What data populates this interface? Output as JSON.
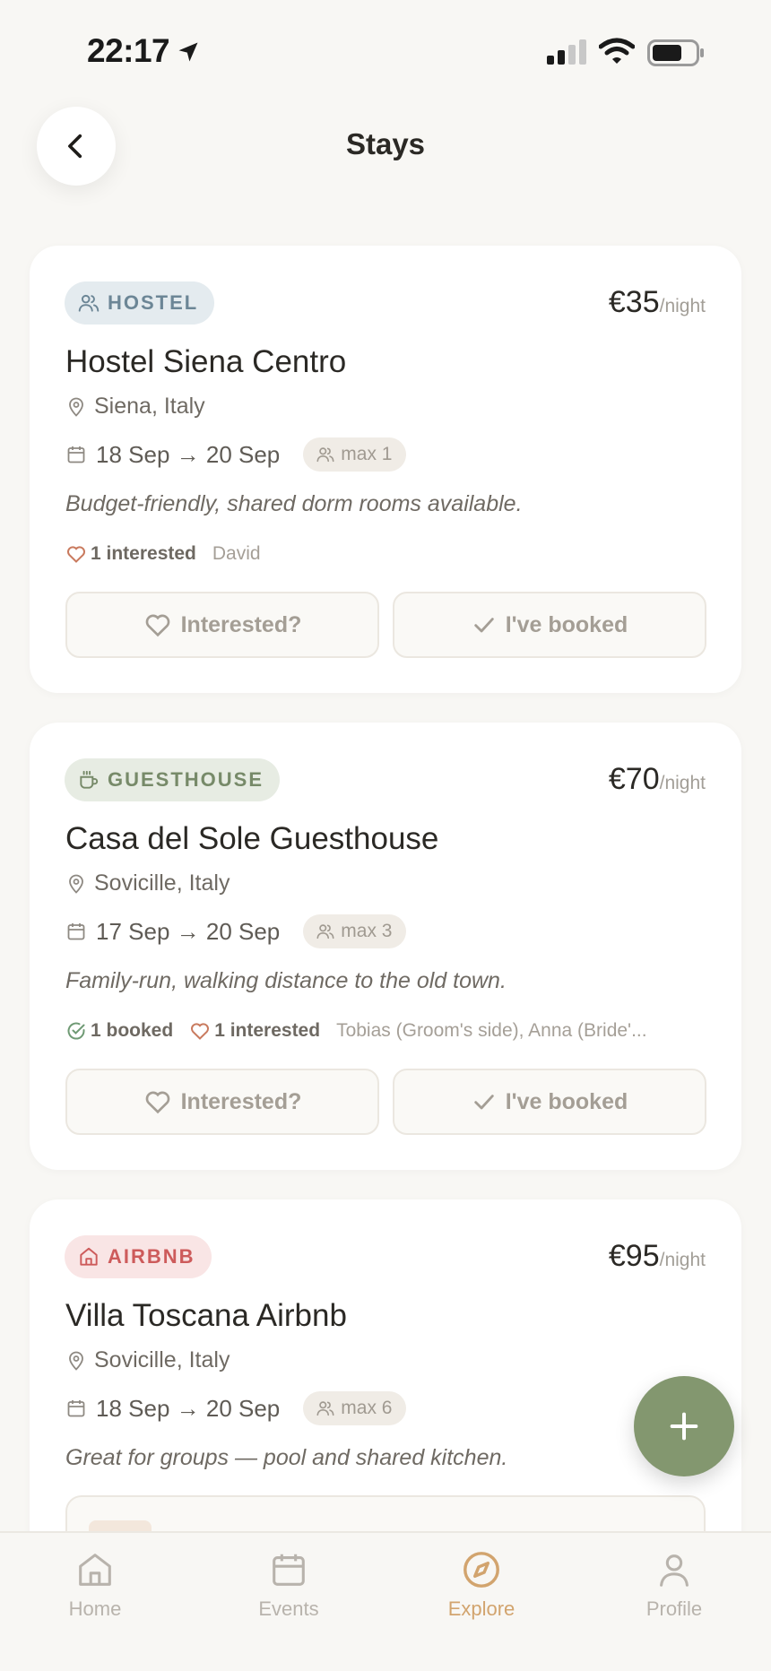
{
  "status_bar": {
    "time": "22:17"
  },
  "header": {
    "title": "Stays"
  },
  "stays": [
    {
      "type_label": "HOSTEL",
      "price": "€35",
      "per_night": "/night",
      "name": "Hostel Siena Centro",
      "location": "Siena, Italy",
      "dates": "18 Sep → 20 Sep",
      "max": "max 1",
      "description": "Budget-friendly, shared dorm rooms available.",
      "interested": "1 interested",
      "names": "David",
      "interested_btn": "Interested?",
      "booked_btn": "I've booked"
    },
    {
      "type_label": "GUESTHOUSE",
      "price": "€70",
      "per_night": "/night",
      "name": "Casa del Sole Guesthouse",
      "location": "Sovicille, Italy",
      "dates": "17 Sep → 20 Sep",
      "max": "max 3",
      "description": "Family-run, walking distance to the old town.",
      "booked": "1 booked",
      "interested": "1 interested",
      "names": "Tobias (Groom's side), Anna (Bride'...",
      "interested_btn": "Interested?",
      "booked_btn": "I've booked"
    },
    {
      "type_label": "AIRBNB",
      "price": "€95",
      "per_night": "/night",
      "name": "Villa Toscana Airbnb",
      "location": "Sovicille, Italy",
      "dates": "18 Sep → 20 Sep",
      "max": "max 6",
      "description": "Great for groups — pool and shared kitchen."
    }
  ],
  "tabs": [
    {
      "label": "Home",
      "icon": "home-icon"
    },
    {
      "label": "Events",
      "icon": "calendar-icon"
    },
    {
      "label": "Explore",
      "icon": "compass-icon",
      "active": true
    },
    {
      "label": "Profile",
      "icon": "person-icon"
    }
  ],
  "colors": {
    "accent": "#d2a46e",
    "fab": "#83976f",
    "hostel": "#6c8696",
    "guesthouse": "#778a69",
    "airbnb": "#cd5b5b",
    "heart": "#c97a5e",
    "check": "#6f9a74"
  }
}
